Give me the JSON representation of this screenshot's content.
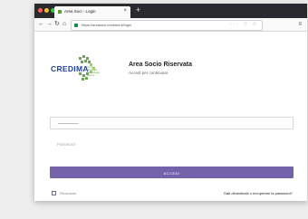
{
  "browser": {
    "tab_title": "Area Soci - Login",
    "tab_close": "×",
    "new_tab": "+",
    "url": "https://areasoci.credima.it/login",
    "nav": {
      "back": "←",
      "forward": "→",
      "reload": "↻",
      "home": "⌂"
    },
    "url_icons": "··· ♡ ☆",
    "menu": "≡"
  },
  "colors": {
    "brand_blue": "#1f3f9e",
    "brand_green": "#6aa84f",
    "accent": "#7463ab"
  },
  "logo": {
    "name": "CREDIMA",
    "tagline": "Centro Regionale Diabetologia Marche"
  },
  "header": {
    "title": "Area Socio Riservata",
    "subtitle": "Accedi per continuare"
  },
  "form": {
    "username_value": "—————",
    "password_placeholder": "Password",
    "submit_label": "ACCEDI",
    "remember_label": "Ricordami",
    "forgot_label": "Dati dimenticati o recuperare la password?"
  }
}
